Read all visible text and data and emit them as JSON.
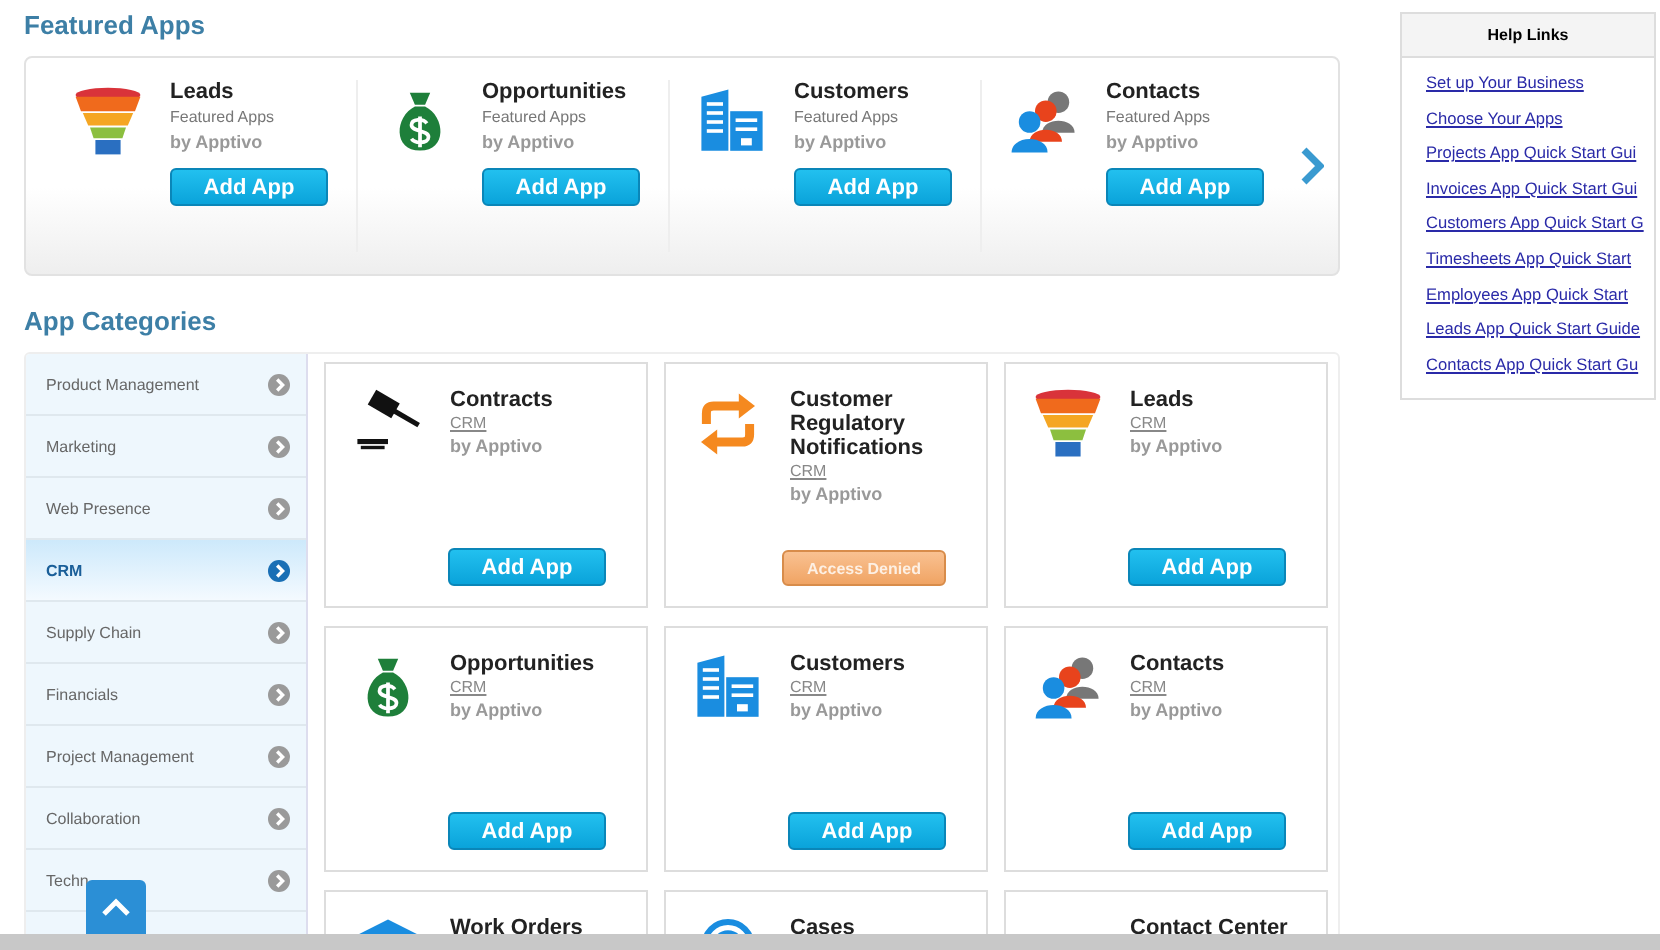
{
  "featured": {
    "title": "Featured Apps",
    "apps": [
      {
        "kind": "funnel",
        "name": "Leads",
        "subtitle": "Featured Apps",
        "vendor": "by Apptivo",
        "button": "Add App"
      },
      {
        "kind": "money",
        "name": "Opportunities",
        "subtitle": "Featured Apps",
        "vendor": "by Apptivo",
        "button": "Add App"
      },
      {
        "kind": "building",
        "name": "Customers",
        "subtitle": "Featured Apps",
        "vendor": "by Apptivo",
        "button": "Add App"
      },
      {
        "kind": "people",
        "name": "Contacts",
        "subtitle": "Featured Apps",
        "vendor": "by Apptivo",
        "button": "Add App"
      }
    ]
  },
  "categories": {
    "title": "App Categories",
    "items": [
      {
        "label": "Product Management",
        "selected": false
      },
      {
        "label": "Marketing",
        "selected": false
      },
      {
        "label": "Web Presence",
        "selected": false
      },
      {
        "label": "CRM",
        "selected": true
      },
      {
        "label": "Supply Chain",
        "selected": false
      },
      {
        "label": "Financials",
        "selected": false
      },
      {
        "label": "Project Management",
        "selected": false
      },
      {
        "label": "Collaboration",
        "selected": false
      },
      {
        "label": "Techn",
        "selected": false
      }
    ],
    "apps": [
      {
        "kind": "gavel",
        "name": "Contracts",
        "category": "CRM",
        "vendor": "by Apptivo",
        "button": {
          "kind": "add",
          "label": "Add App"
        }
      },
      {
        "kind": "sync",
        "name": "Customer Regulatory Notifications",
        "category": "CRM",
        "vendor": "by Apptivo",
        "button": {
          "kind": "denied",
          "label": "Access Denied"
        }
      },
      {
        "kind": "funnel",
        "name": "Leads",
        "category": "CRM",
        "vendor": "by Apptivo",
        "button": {
          "kind": "add",
          "label": "Add App"
        }
      },
      {
        "kind": "money",
        "name": "Opportunities",
        "category": "CRM",
        "vendor": "by Apptivo",
        "button": {
          "kind": "add",
          "label": "Add App"
        }
      },
      {
        "kind": "building",
        "name": "Customers",
        "category": "CRM",
        "vendor": "by Apptivo",
        "button": {
          "kind": "add",
          "label": "Add App"
        }
      },
      {
        "kind": "people",
        "name": "Contacts",
        "category": "CRM",
        "vendor": "by Apptivo",
        "button": {
          "kind": "add",
          "label": "Add App"
        }
      },
      {
        "kind": "wrench",
        "name": "Work Orders"
      },
      {
        "kind": "radar",
        "name": "Cases"
      },
      {
        "name": "Contact Center"
      }
    ]
  },
  "help": {
    "title": "Help Links",
    "links": [
      "Set up Your Business",
      "Choose Your Apps",
      "Projects App Quick Start Gui",
      "Invoices App Quick Start Gui",
      "Customers App Quick Start G",
      "Timesheets App Quick Start",
      "Employees App Quick Start",
      "Leads App Quick Start Guide",
      "Contacts App Quick Start Gu"
    ]
  }
}
